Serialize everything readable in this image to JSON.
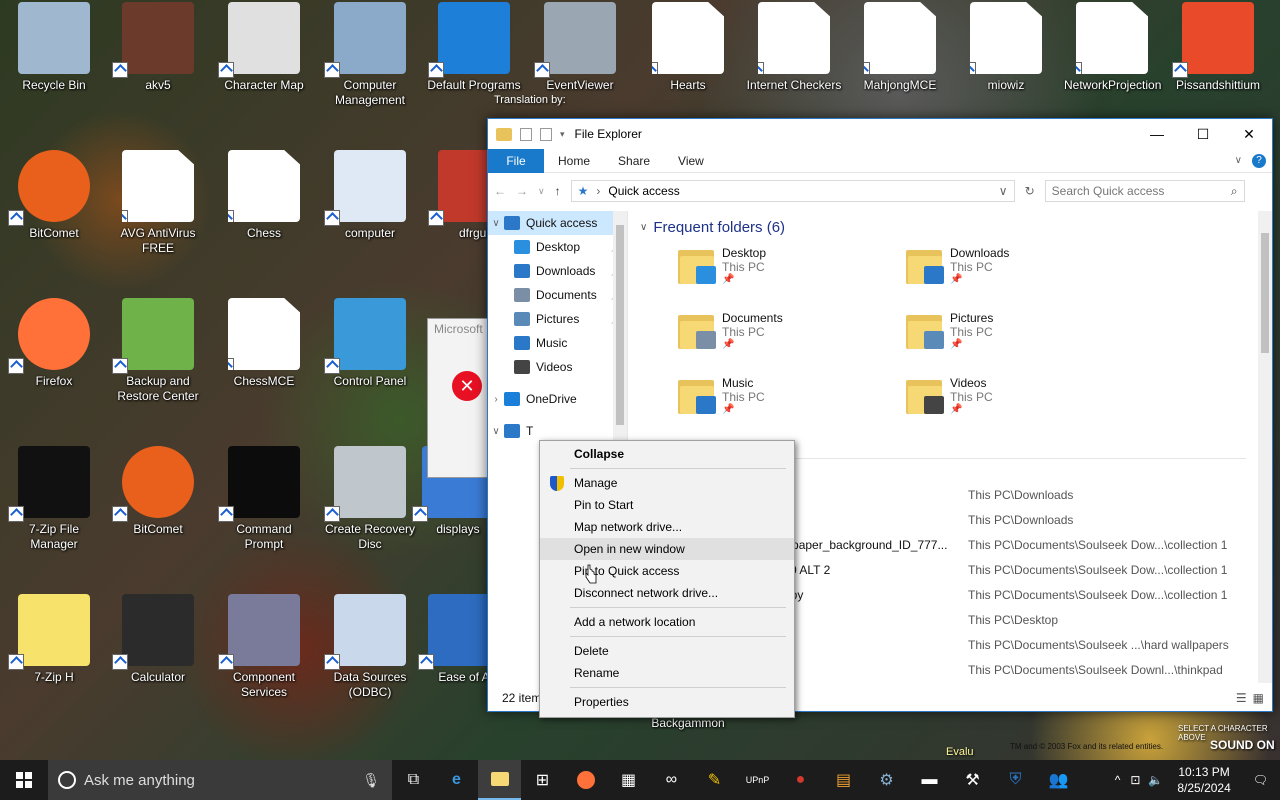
{
  "desktop_icons": [
    {
      "label": "Recycle Bin",
      "color": "#9fb8d0"
    },
    {
      "label": "akv5",
      "color": "#6b3a2a"
    },
    {
      "label": "Character Map",
      "color": "#e0e0e0"
    },
    {
      "label": "Computer Management",
      "color": "#8ba9c9"
    },
    {
      "label": "Default Programs",
      "color": "#1e7fd8"
    },
    {
      "label": "EventViewer",
      "color": "#9aa7b3"
    },
    {
      "label": "Hearts",
      "color": "#ffffff"
    },
    {
      "label": "Internet Checkers",
      "color": "#ffffff"
    },
    {
      "label": "MahjongMCE",
      "color": "#ffffff"
    },
    {
      "label": "miowiz",
      "color": "#ffffff"
    },
    {
      "label": "NetworkProjection",
      "color": "#ffffff"
    },
    {
      "label": "Pissandshittium",
      "color": "#e84a2a"
    },
    {
      "label": "BitComet",
      "color": "#e8601c"
    },
    {
      "label": "AVG AntiVirus FREE",
      "color": "#ffffff"
    },
    {
      "label": "Chess",
      "color": "#ffffff"
    },
    {
      "label": "computer",
      "color": "#dfe9f5"
    },
    {
      "label": "dfrgui",
      "color": "#c0392b"
    },
    {
      "label": "Firefox",
      "color": "#ff7139"
    },
    {
      "label": "Backup and Restore Center",
      "color": "#6fb24a"
    },
    {
      "label": "ChessMCE",
      "color": "#ffffff"
    },
    {
      "label": "Control Panel",
      "color": "#3a9ad9"
    },
    {
      "label": "7-Zip File Manager",
      "color": "#111111"
    },
    {
      "label": "BitComet",
      "color": "#e8601c"
    },
    {
      "label": "Command Prompt",
      "color": "#0c0c0c"
    },
    {
      "label": "Create Recovery Disc",
      "color": "#bfc6cc"
    },
    {
      "label": "displays",
      "color": "#3a7bd5"
    },
    {
      "label": "7-Zip H",
      "color": "#f7e26b"
    },
    {
      "label": "Calculator",
      "color": "#2b2b2b"
    },
    {
      "label": "Component Services",
      "color": "#7a7a9a"
    },
    {
      "label": "Data Sources (ODBC)",
      "color": "#c9d8ea"
    },
    {
      "label": "Ease of A",
      "color": "#2d6cc0"
    },
    {
      "label": "Backgammon",
      "color": "#7a5a3a"
    }
  ],
  "error_dialog": {
    "title": "Microsoft"
  },
  "explorer": {
    "title": "File Explorer",
    "window_buttons": {
      "minimize": "—",
      "maximize": "☐",
      "close": "✕"
    },
    "ribbon_tabs": [
      "File",
      "Home",
      "Share",
      "View"
    ],
    "address": "Quick access",
    "search_placeholder": "Search Quick access",
    "nav_items": [
      {
        "label": "Quick access",
        "arrow": "∨",
        "color": "#2b78c8",
        "selected": true
      },
      {
        "label": "Desktop",
        "arrow": "",
        "color": "#2b8fe0",
        "pinned": true
      },
      {
        "label": "Downloads",
        "arrow": "",
        "color": "#2b78c8",
        "pinned": true
      },
      {
        "label": "Documents",
        "arrow": "",
        "color": "#7a8fa6",
        "pinned": true
      },
      {
        "label": "Pictures",
        "arrow": "",
        "color": "#5a8ab8",
        "pinned": true
      },
      {
        "label": "Music",
        "arrow": "",
        "color": "#2b78c8"
      },
      {
        "label": "Videos",
        "arrow": "",
        "color": "#444444"
      },
      {
        "label": "OneDrive",
        "arrow": "›",
        "color": "#1a7fd8"
      },
      {
        "label": "T",
        "arrow": "∨",
        "color": "#2b78c8"
      }
    ],
    "frequent_header": "Frequent folders (6)",
    "frequent_folders": [
      {
        "name": "Desktop",
        "location": "This PC",
        "badge": "#2b8fe0"
      },
      {
        "name": "Downloads",
        "location": "This PC",
        "badge": "#2b78c8"
      },
      {
        "name": "Documents",
        "location": "This PC",
        "badge": "#7a8fa6"
      },
      {
        "name": "Pictures",
        "location": "This PC",
        "badge": "#5a8ab8"
      },
      {
        "name": "Music",
        "location": "This PC",
        "badge": "#2b78c8"
      },
      {
        "name": "Videos",
        "location": "This PC",
        "badge": "#444444"
      }
    ],
    "recent_files": [
      {
        "name": "",
        "path": "This PC\\Downloads"
      },
      {
        "name": "",
        "path": "This PC\\Downloads"
      },
      {
        "name": "n_wallpaper_background_ID_777...",
        "path": "This PC\\Documents\\Soulseek Dow...\\collection 1"
      },
      {
        "name": "e C100 ALT 2",
        "path": "This PC\\Documents\\Soulseek Dow...\\collection 1"
      },
      {
        "name": "0 - Copy",
        "path": "This PC\\Documents\\Soulseek Dow...\\collection 1"
      },
      {
        "name": "",
        "path": "This PC\\Desktop"
      },
      {
        "name": "",
        "path": "This PC\\Documents\\Soulseek ...\\hard wallpapers"
      },
      {
        "name": "",
        "path": "This PC\\Documents\\Soulseek Downl...\\thinkpad"
      }
    ],
    "status": "22 item"
  },
  "context_menu": {
    "items": [
      {
        "label": "Collapse",
        "bold": true
      },
      {
        "sep": true
      },
      {
        "label": "Manage",
        "shield": true
      },
      {
        "label": "Pin to Start"
      },
      {
        "label": "Map network drive..."
      },
      {
        "label": "Open in new window",
        "hover": true
      },
      {
        "label": "Pin to Quick access"
      },
      {
        "label": "Disconnect network drive..."
      },
      {
        "sep": true
      },
      {
        "label": "Add a network location"
      },
      {
        "sep": true
      },
      {
        "label": "Delete"
      },
      {
        "label": "Rename"
      },
      {
        "sep": true
      },
      {
        "label": "Properties"
      }
    ]
  },
  "taskbar": {
    "search_placeholder": "Ask me anything",
    "time": "10:13 PM",
    "date": "8/25/2024",
    "accent": "#76b9ed"
  },
  "decor": {
    "translation": "Translation by:",
    "copyright": "TM and © 2003 Fox and its related entities.",
    "select": "SELECT A CHARACTER ABOVE",
    "sound": "SOUND ON",
    "evalu": "Evalu"
  }
}
